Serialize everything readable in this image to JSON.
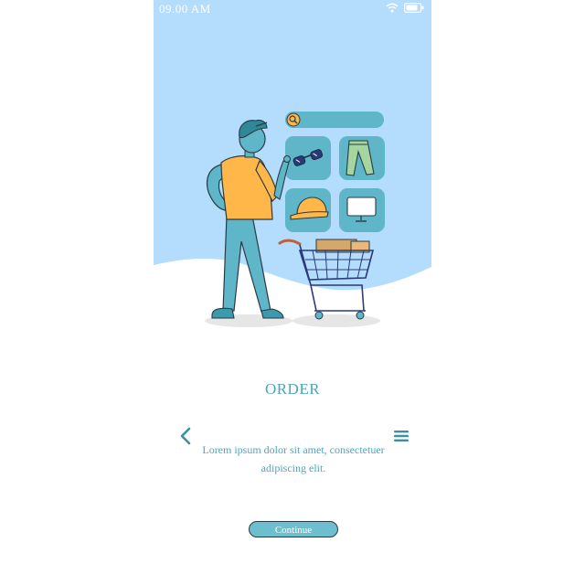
{
  "status_bar": {
    "time": "09.00 AM",
    "wifi_icon": "wifi-icon",
    "battery_icon": "battery-icon"
  },
  "screen": {
    "title": "ORDER",
    "description": "Lorem ipsum dolor sit amet, consectetuer adipiscing elit.",
    "continue_label": "Continue",
    "back_icon": "chevron-left-icon",
    "menu_icon": "hamburger-menu-icon"
  },
  "colors": {
    "accent": "#4aa6bb",
    "sky": "#b3dcfd",
    "button": "#6dbfcf",
    "tile": "#5fb6c8",
    "shirt": "#ffb74a"
  }
}
